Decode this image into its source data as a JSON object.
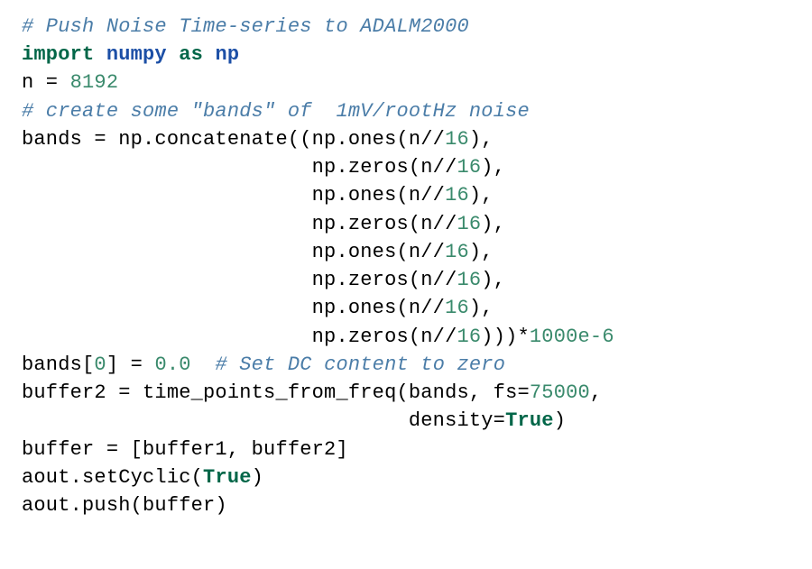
{
  "code": {
    "l1_comment": "# Push Noise Time-series to ADALM2000",
    "l2_import": "import",
    "l2_numpy": "numpy",
    "l2_as": "as",
    "l2_np": "np",
    "l3_a": "n = ",
    "l3_num": "8192",
    "l4_comment": "# create some \"bands\" of  1mV/rootHz noise",
    "l5_a": "bands = np.concatenate((np.ones(n//",
    "l5_num": "16",
    "l5_b": "),",
    "l6_pad": "                        np.zeros(n//",
    "l6_num": "16",
    "l6_b": "),",
    "l7_pad": "                        np.ones(n//",
    "l7_num": "16",
    "l7_b": "),",
    "l8_pad": "                        np.zeros(n//",
    "l8_num": "16",
    "l8_b": "),",
    "l9_pad": "                        np.ones(n//",
    "l9_num": "16",
    "l9_b": "),",
    "l10_pad": "                        np.zeros(n//",
    "l10_num": "16",
    "l10_b": "),",
    "l11_pad": "                        np.ones(n//",
    "l11_num": "16",
    "l11_b": "),",
    "l12_pad": "                        np.zeros(n//",
    "l12_num": "16",
    "l12_b": ")))*",
    "l12_num2": "1000e-6",
    "l13_a": "bands[",
    "l13_idx": "0",
    "l13_b": "] = ",
    "l13_val": "0.0  ",
    "l13_comment": "# Set DC content to zero",
    "l14_a": "buffer2 = time_points_from_freq(bands, fs=",
    "l14_num": "75000",
    "l14_b": ",",
    "l15_pad": "                                density=",
    "l15_bool": "True",
    "l15_b": ")",
    "l16": "buffer = [buffer1, buffer2]",
    "l17_a": "aout.setCyclic(",
    "l17_bool": "True",
    "l17_b": ")",
    "l18": "aout.push(buffer)"
  }
}
